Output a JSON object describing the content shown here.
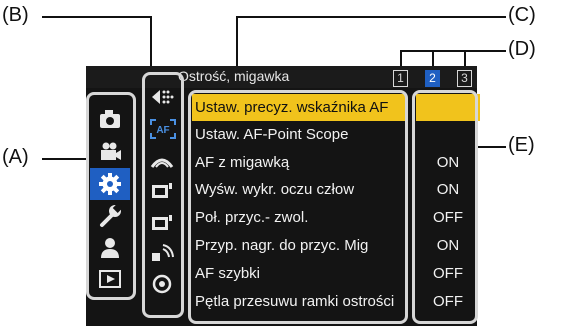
{
  "header": {
    "title": "Ostrość, migawka",
    "pages": [
      "1",
      "2",
      "3"
    ],
    "active_page": "2"
  },
  "side_tabs": [
    {
      "icon": "camera-icon"
    },
    {
      "icon": "video-camera-icon"
    },
    {
      "icon": "gear-icon",
      "selected": true
    },
    {
      "icon": "wrench-icon"
    },
    {
      "icon": "person-icon"
    },
    {
      "icon": "playback-icon"
    }
  ],
  "sub_tabs": [
    {
      "icon": "scroll-arrows-icon"
    },
    {
      "icon": "af-bracket-icon",
      "label": "AF"
    },
    {
      "icon": "display-arc-icon"
    },
    {
      "icon": "monitor-icon"
    },
    {
      "icon": "monitor-out-icon"
    },
    {
      "icon": "wireless-icon"
    },
    {
      "icon": "lens-ring-icon"
    }
  ],
  "menu_items": [
    {
      "label": "Ustaw. precyz. wskaźnika AF",
      "value": ""
    },
    {
      "label": "Ustaw. AF-Point Scope",
      "value": ""
    },
    {
      "label": "AF z migawką",
      "value": "ON"
    },
    {
      "label": "Wyśw. wykr. oczu człow",
      "value": "ON"
    },
    {
      "label": "Poł. przyc.- zwol.",
      "value": "OFF"
    },
    {
      "label": "Przyp. nagr. do przyc. Mig",
      "value": "ON"
    },
    {
      "label": "AF szybki",
      "value": "OFF"
    },
    {
      "label": "Pętla przesuwu ramki ostrości",
      "value": "OFF"
    }
  ],
  "callouts": {
    "a": "(A)",
    "b": "(B)",
    "c": "(C)",
    "d": "(D)",
    "e": "(E)"
  },
  "colors": {
    "highlight": "#f1c31c",
    "tab_selected": "#1f5fc2",
    "bracket": "#d7d7d7"
  }
}
